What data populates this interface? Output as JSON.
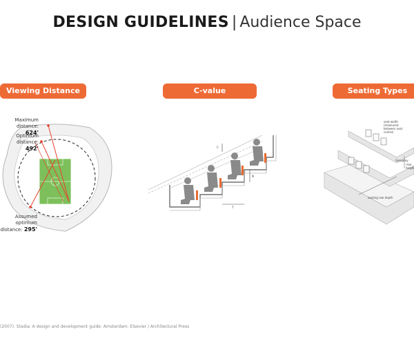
{
  "title": {
    "bold": "DESIGN GUIDELINES",
    "separator": "|",
    "light": "Audience Space"
  },
  "panels": [
    {
      "label": "Viewing Distance"
    },
    {
      "label": "C-value"
    },
    {
      "label": "Seating Types"
    }
  ],
  "viewing": {
    "max_label": "Maximum distance:",
    "max_value": "624'",
    "opt_label": "Optimum distance:",
    "opt_value": "492'",
    "assumed_label_1": "Assumed optimum",
    "assumed_label_2": "distance:",
    "assumed_value": "295'"
  },
  "cvalue": {
    "c_label": "C",
    "n_label": "N",
    "t_label": "T"
  },
  "seating": {
    "seat_width_note": "seat width (measured between seat centre)",
    "row_depth_note": "seating row depth",
    "gangway_note": "Gangway",
    "row_height_note": "riser height"
  },
  "footer": "(2007). Stadia: A design and development guide. Amsterdam: Elsevier / Architectural Press",
  "colors": {
    "accent": "#ee6a35",
    "pitch": "#7dc05b",
    "seat": "#e86a30",
    "figure": "#8a8a8a"
  }
}
